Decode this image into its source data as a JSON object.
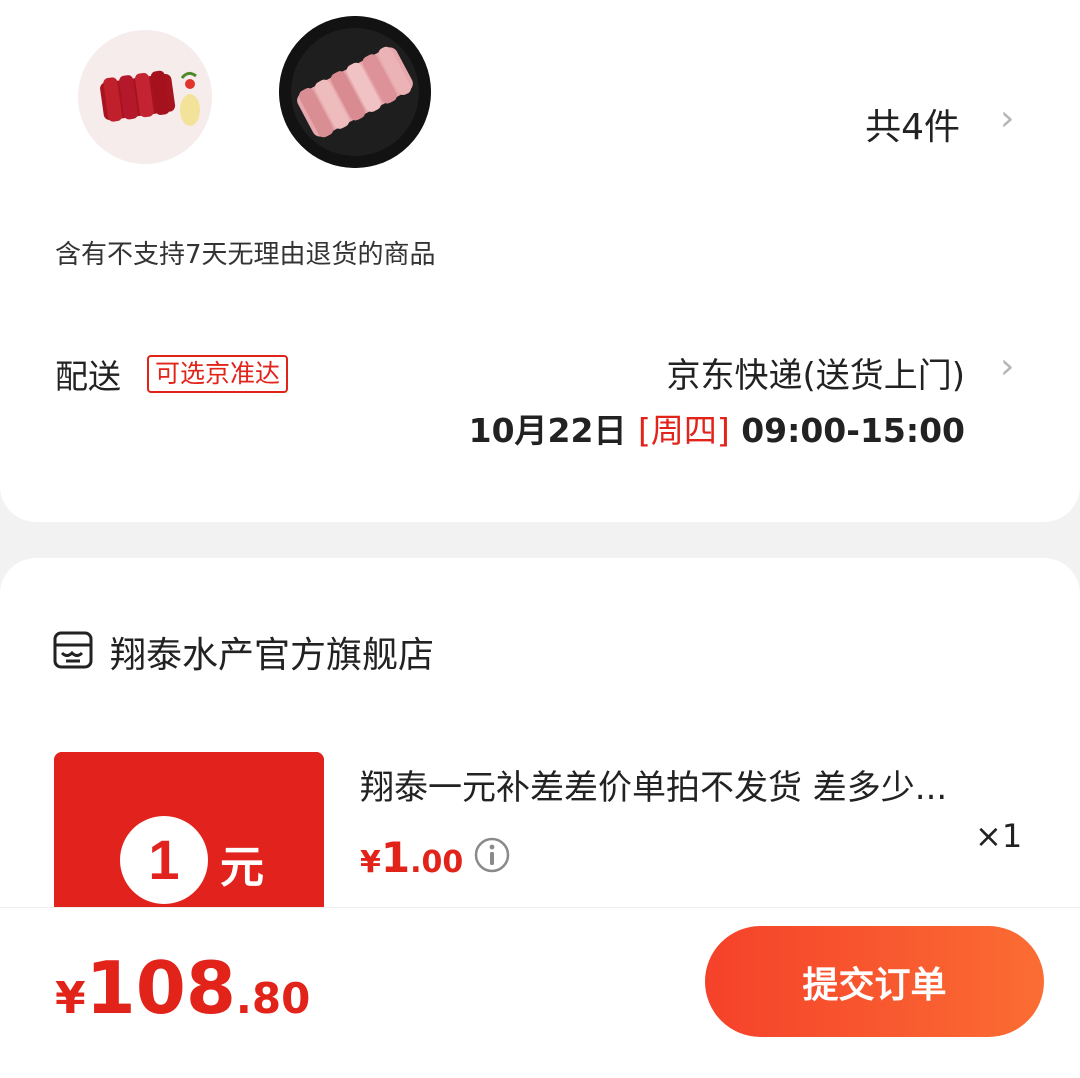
{
  "goods": {
    "count_label": "共4件",
    "items": [
      {
        "icon": "beef-slices-image"
      },
      {
        "icon": "lamb-roll-slices-image"
      }
    ]
  },
  "return_note": "含有不支持7天无理由退货的商品",
  "delivery": {
    "label": "配送",
    "tag": "可选京准达",
    "method": "京东快递(送货上门)",
    "date": "10月22日",
    "weekday": "[周四]",
    "time_range": "09:00-15:00"
  },
  "store": {
    "icon": "store-icon",
    "name": "翔泰水产官方旗舰店"
  },
  "product": {
    "image_text_number": "1",
    "image_text_unit": "元",
    "title": "翔泰一元补差差价单拍不发货 差多少...",
    "price_currency": "¥",
    "price_int": "1",
    "price_dec": ".00",
    "quantity": "×1"
  },
  "footer": {
    "total_currency": "¥",
    "total_int": "108",
    "total_dec": ".80",
    "submit_label": "提交订单"
  },
  "colors": {
    "accent": "#e2231a",
    "button_start": "#f5412a",
    "button_end": "#fb6d33"
  }
}
